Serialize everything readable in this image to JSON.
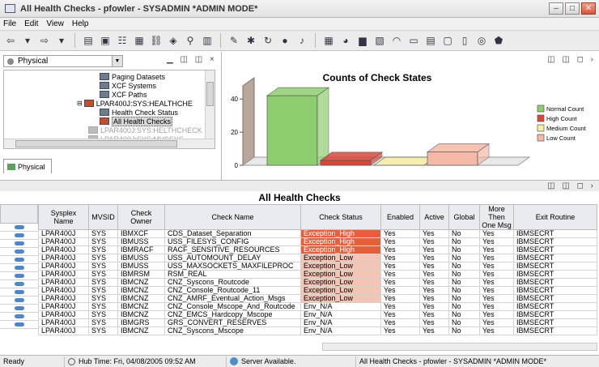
{
  "window": {
    "title": "All Health Checks - pfowler - SYSADMIN  *ADMIN MODE*"
  },
  "menu": [
    "File",
    "Edit",
    "View",
    "Help"
  ],
  "left_pane": {
    "view_select": "Physical",
    "tree": [
      {
        "label": "Paging Datasets",
        "state": "normal"
      },
      {
        "label": "XCF Systems",
        "state": "normal"
      },
      {
        "label": "XCF Paths",
        "state": "normal"
      },
      {
        "label": "LPAR400J:SYS:HEALTHCHE",
        "state": "normal"
      },
      {
        "label": "Health Check Status",
        "state": "normal"
      },
      {
        "label": "All Health Checks",
        "state": "selected"
      },
      {
        "label": "LPAR400J:SYS:HELTHCHECK",
        "state": "disabled"
      },
      {
        "label": "LPAR400J:SYS:MVSSYS",
        "state": "disabled"
      }
    ],
    "tab_label": "Physical"
  },
  "chart_data": {
    "type": "bar",
    "title": "Counts of Check States",
    "categories": [
      "Normal Count",
      "High Count",
      "Medium Count",
      "Low Count"
    ],
    "values": [
      42,
      3,
      0,
      8
    ],
    "ylim": [
      0,
      45
    ],
    "yticks": [
      "0",
      "20",
      "40"
    ],
    "colors": [
      "#8fce6f",
      "#d8473a",
      "#f6efa6",
      "#f5b9a7"
    ],
    "legend": [
      "Normal Count",
      "High Count",
      "Medium Count",
      "Low Count"
    ],
    "legend_position": "right"
  },
  "table": {
    "title": "All Health Checks",
    "columns": [
      "Sysplex Name",
      "MVSID",
      "Check Owner",
      "Check Name",
      "Check Status",
      "Enabled",
      "Active",
      "Global",
      "More Then One Msg",
      "Exit Routine"
    ],
    "rows": [
      [
        "LPAR400J",
        "SYS",
        "IBMXCF",
        "CDS_Dataset_Separation",
        "Exception_High",
        "Yes",
        "Yes",
        "No",
        "Yes",
        "IBMSECRT"
      ],
      [
        "LPAR400J",
        "SYS",
        "IBMUSS",
        "USS_FILESYS_CONFIG",
        "Exception_High",
        "Yes",
        "Yes",
        "No",
        "Yes",
        "IBMSECRT"
      ],
      [
        "LPAR400J",
        "SYS",
        "IBMRACF",
        "RACF_SENSITIVE_RESOURCES",
        "Exception_High",
        "Yes",
        "Yes",
        "No",
        "Yes",
        "IBMSECRT"
      ],
      [
        "LPAR400J",
        "SYS",
        "IBMUSS",
        "USS_AUTOMOUNT_DELAY",
        "Exception_Low",
        "Yes",
        "Yes",
        "No",
        "Yes",
        "IBMSECRT"
      ],
      [
        "LPAR400J",
        "SYS",
        "IBMUSS",
        "USS_MAXSOCKETS_MAXFILEPROC",
        "Exception_Low",
        "Yes",
        "Yes",
        "No",
        "Yes",
        "IBMSECRT"
      ],
      [
        "LPAR400J",
        "SYS",
        "IBMRSM",
        "RSM_REAL",
        "Exception_Low",
        "Yes",
        "Yes",
        "No",
        "Yes",
        "IBMSECRT"
      ],
      [
        "LPAR400J",
        "SYS",
        "IBMCNZ",
        "CNZ_Syscons_Routcode",
        "Exception_Low",
        "Yes",
        "Yes",
        "No",
        "Yes",
        "IBMSECRT"
      ],
      [
        "LPAR400J",
        "SYS",
        "IBMCNZ",
        "CNZ_Console_Routcode_11",
        "Exception_Low",
        "Yes",
        "Yes",
        "No",
        "Yes",
        "IBMSECRT"
      ],
      [
        "LPAR400J",
        "SYS",
        "IBMCNZ",
        "CNZ_AMRF_Eventual_Action_Msgs",
        "Exception_Low",
        "Yes",
        "Yes",
        "No",
        "Yes",
        "IBMSECRT"
      ],
      [
        "LPAR400J",
        "SYS",
        "IBMCNZ",
        "CNZ_Console_Mscope_And_Routcode",
        "Env_N/A",
        "Yes",
        "Yes",
        "No",
        "Yes",
        "IBMSECRT"
      ],
      [
        "LPAR400J",
        "SYS",
        "IBMCNZ",
        "CNZ_EMCS_Hardcopy_Mscope",
        "Env_N/A",
        "Yes",
        "Yes",
        "No",
        "Yes",
        "IBMSECRT"
      ],
      [
        "LPAR400J",
        "SYS",
        "IBMGRS",
        "GRS_CONVERT_RESERVES",
        "Env_N/A",
        "Yes",
        "Yes",
        "No",
        "Yes",
        "IBMSECRT"
      ],
      [
        "LPAR400J",
        "SYS",
        "IBMCNZ",
        "CNZ_Syscons_Mscope",
        "Env_N/A",
        "Yes",
        "Yes",
        "No",
        "Yes",
        "IBMSECRT"
      ]
    ]
  },
  "status_bar": {
    "state": "Ready",
    "hub_time": "Hub Time: Fri, 04/08/2005 09:52 AM",
    "server": "Server Available.",
    "context": "All Health Checks - pfowler - SYSADMIN  *ADMIN MODE*"
  }
}
